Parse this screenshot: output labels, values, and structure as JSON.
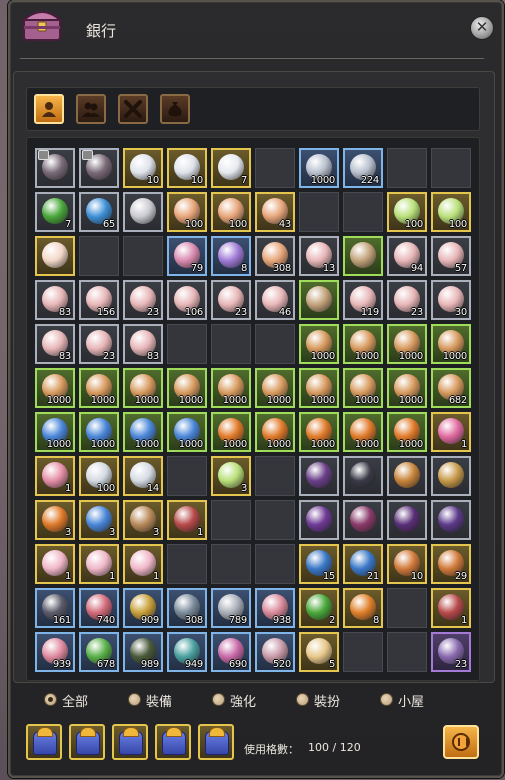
{
  "window": {
    "title": "銀行",
    "close_symbol": "✕"
  },
  "tabs": [
    {
      "name": "tab-character",
      "icon": "character-bust-icon",
      "active": true
    },
    {
      "name": "tab-shared",
      "icon": "two-characters-icon",
      "active": false
    },
    {
      "name": "tab-cross",
      "icon": "crossed-tools-icon",
      "active": false
    },
    {
      "name": "tab-bag",
      "icon": "money-bag-icon",
      "active": false
    }
  ],
  "rarity_colors": {
    "white": "#a9b0bb",
    "gold": "#e4c64f",
    "green": "#9fdc5a",
    "blue": "#7fb4e8",
    "purple": "#a57ad6"
  },
  "slots": [
    [
      {
        "i": "armor-locked-icon",
        "r": "white",
        "q": "",
        "lock": true
      },
      {
        "i": "armor-locked-icon",
        "r": "white",
        "q": "",
        "lock": true
      },
      {
        "i": "silver-cubes-icon",
        "r": "gold",
        "q": "10"
      },
      {
        "i": "silver-cubes-icon",
        "r": "gold",
        "q": "10"
      },
      {
        "i": "silver-heart-icon",
        "r": "gold",
        "q": "7"
      },
      null,
      {
        "i": "silver-coin-icon",
        "r": "blue",
        "q": "1000"
      },
      {
        "i": "silver-coin-icon",
        "r": "blue",
        "q": "224"
      },
      null,
      null
    ],
    [
      {
        "i": "green-gem-icon",
        "r": "white",
        "q": "7"
      },
      {
        "i": "blue-orb-icon",
        "r": "white",
        "q": "65"
      },
      {
        "i": "skull-mask-icon",
        "r": "white",
        "q": ""
      },
      {
        "i": "horn-icon",
        "r": "gold",
        "q": "100"
      },
      {
        "i": "horn-icon",
        "r": "gold",
        "q": "100"
      },
      {
        "i": "horn-icon",
        "r": "gold",
        "q": "43"
      },
      null,
      null,
      {
        "i": "rainbow-scroll-icon",
        "r": "gold",
        "q": "100"
      },
      {
        "i": "rainbow-scroll-icon",
        "r": "gold",
        "q": "100"
      }
    ],
    [
      {
        "i": "portrait-card-icon",
        "r": "gold",
        "q": ""
      },
      null,
      null,
      {
        "i": "crystal-shard-icon",
        "r": "blue",
        "q": "79"
      },
      {
        "i": "purple-crystal-icon",
        "r": "blue",
        "q": "8"
      },
      {
        "i": "horn-icon",
        "r": "white",
        "q": "308"
      },
      {
        "i": "pink-fox-icon",
        "r": "white",
        "q": "13"
      },
      {
        "i": "scissors-icon",
        "r": "green",
        "q": ""
      },
      {
        "i": "pink-fox-icon",
        "r": "white",
        "q": "94"
      },
      {
        "i": "pink-fox-icon",
        "r": "white",
        "q": "57"
      }
    ],
    [
      {
        "i": "pink-fox-icon",
        "r": "white",
        "q": "83"
      },
      {
        "i": "pink-fox-icon",
        "r": "white",
        "q": "156"
      },
      {
        "i": "pink-fox-icon",
        "r": "white",
        "q": "23"
      },
      {
        "i": "pink-fox-icon",
        "r": "white",
        "q": "106"
      },
      {
        "i": "pink-fox-icon",
        "r": "white",
        "q": "23"
      },
      {
        "i": "pink-fox-icon",
        "r": "white",
        "q": "46"
      },
      {
        "i": "scissors-icon",
        "r": "green",
        "q": ""
      },
      {
        "i": "pink-fox-icon",
        "r": "white",
        "q": "119"
      },
      {
        "i": "pink-fox-icon",
        "r": "white",
        "q": "23"
      },
      {
        "i": "pink-fox-icon",
        "r": "white",
        "q": "30"
      }
    ],
    [
      {
        "i": "pink-fox-icon",
        "r": "white",
        "q": "83"
      },
      {
        "i": "pink-fox-icon",
        "r": "white",
        "q": "23"
      },
      {
        "i": "pink-fox-icon",
        "r": "white",
        "q": "83"
      },
      null,
      null,
      null,
      {
        "i": "coin-pouch-icon",
        "r": "green",
        "q": "1000"
      },
      {
        "i": "coin-pouch-icon",
        "r": "green",
        "q": "1000"
      },
      {
        "i": "coin-pouch-icon",
        "r": "green",
        "q": "1000"
      },
      {
        "i": "coin-pouch-icon",
        "r": "green",
        "q": "1000"
      }
    ],
    [
      {
        "i": "coin-pouch-icon",
        "r": "green",
        "q": "1000"
      },
      {
        "i": "coin-pouch-icon",
        "r": "green",
        "q": "1000"
      },
      {
        "i": "coin-pouch-icon",
        "r": "green",
        "q": "1000"
      },
      {
        "i": "coin-pouch-icon",
        "r": "green",
        "q": "1000"
      },
      {
        "i": "coin-pouch-icon",
        "r": "green",
        "q": "1000"
      },
      {
        "i": "coin-pouch-icon",
        "r": "green",
        "q": "1000"
      },
      {
        "i": "coin-pouch-icon",
        "r": "green",
        "q": "1000"
      },
      {
        "i": "coin-pouch-icon",
        "r": "green",
        "q": "1000"
      },
      {
        "i": "coin-pouch-icon",
        "r": "green",
        "q": "1000"
      },
      {
        "i": "coin-pouch-icon",
        "r": "green",
        "q": "682"
      }
    ],
    [
      {
        "i": "blue-crystal-pouch-icon",
        "r": "green",
        "q": "1000"
      },
      {
        "i": "blue-crystal-pouch-icon",
        "r": "green",
        "q": "1000"
      },
      {
        "i": "blue-crystal-pouch-icon",
        "r": "green",
        "q": "1000"
      },
      {
        "i": "blue-crystal-pouch-icon",
        "r": "green",
        "q": "1000"
      },
      {
        "i": "orange-crystal-pouch-icon",
        "r": "green",
        "q": "1000"
      },
      {
        "i": "orange-crystal-pouch-icon",
        "r": "green",
        "q": "1000"
      },
      {
        "i": "orange-crystal-pouch-icon",
        "r": "green",
        "q": "1000"
      },
      {
        "i": "orange-crystal-pouch-icon",
        "r": "green",
        "q": "1000"
      },
      {
        "i": "orange-crystal-pouch-icon",
        "r": "green",
        "q": "1000"
      },
      {
        "i": "gift-box-icon",
        "r": "gold",
        "q": "1"
      }
    ],
    [
      {
        "i": "pink-pouch-icon",
        "r": "gold",
        "q": "1"
      },
      {
        "i": "silver-bars-icon",
        "r": "gold",
        "q": "100"
      },
      {
        "i": "silver-bars-icon",
        "r": "gold",
        "q": "14"
      },
      null,
      {
        "i": "rainbow-scroll-icon",
        "r": "gold",
        "q": "3"
      },
      null,
      {
        "i": "purple-boots-icon",
        "r": "white",
        "q": ""
      },
      {
        "i": "dark-hat-icon",
        "r": "white",
        "q": ""
      },
      {
        "i": "bronze-shield-icon",
        "r": "white",
        "q": ""
      },
      {
        "i": "bronze-medal-icon",
        "r": "white",
        "q": ""
      }
    ],
    [
      {
        "i": "orange-crystal-pouch-icon",
        "r": "gold",
        "q": "3"
      },
      {
        "i": "blue-crystal-pouch-icon",
        "r": "gold",
        "q": "3"
      },
      {
        "i": "bronze-pouch-icon",
        "r": "gold",
        "q": "3"
      },
      {
        "i": "treasure-chest-icon",
        "r": "gold",
        "q": "1"
      },
      null,
      null,
      {
        "i": "purple-armor-icon",
        "r": "white",
        "q": ""
      },
      {
        "i": "dark-ring-icon",
        "r": "white",
        "q": ""
      },
      {
        "i": "bat-wings-icon",
        "r": "white",
        "q": ""
      },
      {
        "i": "purple-cape-icon",
        "r": "white",
        "q": ""
      }
    ],
    [
      {
        "i": "flower-box-icon",
        "r": "gold",
        "q": "1"
      },
      {
        "i": "flower-box-icon",
        "r": "gold",
        "q": "1"
      },
      {
        "i": "flower-box-icon",
        "r": "gold",
        "q": "1"
      },
      null,
      null,
      null,
      {
        "i": "blue-star-book-icon",
        "r": "gold",
        "q": "15"
      },
      {
        "i": "blue-star-book-icon",
        "r": "gold",
        "q": "21"
      },
      {
        "i": "hammer-box-icon",
        "r": "gold",
        "q": "10"
      },
      {
        "i": "hammer-box-icon",
        "r": "gold",
        "q": "29"
      }
    ],
    [
      {
        "i": "dark-crab-icon",
        "r": "blue",
        "q": "161"
      },
      {
        "i": "pink-coral-icon",
        "r": "blue",
        "q": "740"
      },
      {
        "i": "gold-branch-icon",
        "r": "blue",
        "q": "909"
      },
      {
        "i": "ore-rock-icon",
        "r": "blue",
        "q": "308"
      },
      {
        "i": "stone-slab-icon",
        "r": "blue",
        "q": "789"
      },
      {
        "i": "pink-fish-icon",
        "r": "blue",
        "q": "938"
      },
      {
        "i": "green-star-book-icon",
        "r": "gold",
        "q": "2"
      },
      {
        "i": "orange-star-book-icon",
        "r": "gold",
        "q": "8"
      },
      null,
      {
        "i": "treasure-chest-icon",
        "r": "gold",
        "q": "1"
      }
    ],
    [
      {
        "i": "pink-shell-icon",
        "r": "blue",
        "q": "939"
      },
      {
        "i": "green-leaf-icon",
        "r": "blue",
        "q": "678"
      },
      {
        "i": "dark-root-icon",
        "r": "blue",
        "q": "989"
      },
      {
        "i": "teal-stone-icon",
        "r": "blue",
        "q": "949"
      },
      {
        "i": "pink-blossom-icon",
        "r": "blue",
        "q": "690"
      },
      {
        "i": "pink-pebble-icon",
        "r": "blue",
        "q": "520"
      },
      {
        "i": "open-book-icon",
        "r": "gold",
        "q": "5"
      },
      null,
      null,
      {
        "i": "purple-chest-icon",
        "r": "purple",
        "q": "23"
      }
    ]
  ],
  "filters": [
    {
      "label": "全部",
      "selected": true
    },
    {
      "label": "裝備",
      "selected": false
    },
    {
      "label": "強化",
      "selected": false
    },
    {
      "label": "裝扮",
      "selected": false
    },
    {
      "label": "小屋",
      "selected": false
    }
  ],
  "quickbar": [
    "blue-gift-bag-icon",
    "blue-gift-bag-icon",
    "blue-gift-bag-icon",
    "blue-gift-bag-icon",
    "blue-gift-bag-icon"
  ],
  "usage": {
    "label": "使用格數：",
    "value": "100 / 120"
  },
  "expand_icon": "expand-slots-icon"
}
